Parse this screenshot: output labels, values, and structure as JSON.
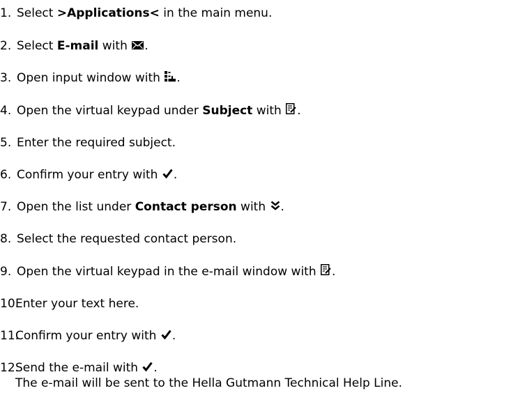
{
  "steps": [
    {
      "num": "1.",
      "pre": "Select ",
      "bold": ">Applications<",
      "post": " in the main menu.",
      "icon": null
    },
    {
      "num": "2.",
      "pre": "Select ",
      "bold": "E-mail",
      "post": " with ",
      "icon": "envelope-icon"
    },
    {
      "num": "3.",
      "pre": "Open input window with ",
      "bold": "",
      "post": "",
      "icon": "new-entry-icon"
    },
    {
      "num": "4.",
      "pre": "Open the virtual keypad under ",
      "bold": "Subject",
      "post": " with ",
      "icon": "edit-icon"
    },
    {
      "num": "5.",
      "pre": "Enter the required subject.",
      "bold": "",
      "post": "",
      "icon": null
    },
    {
      "num": "6.",
      "pre": "Confirm your entry with ",
      "bold": "",
      "post": "",
      "icon": "checkmark-icon"
    },
    {
      "num": "7.",
      "pre": "Open the list under ",
      "bold": "Contact person",
      "post": " with ",
      "icon": "double-chevron-down-icon"
    },
    {
      "num": "8.",
      "pre": "Select the requested contact person.",
      "bold": "",
      "post": "",
      "icon": null
    },
    {
      "num": "9.",
      "pre": "Open the virtual keypad in the e-mail window with ",
      "bold": "",
      "post": "",
      "icon": "edit-icon"
    },
    {
      "num": "10.",
      "pre": "Enter your text here.",
      "bold": "",
      "post": "",
      "icon": null
    },
    {
      "num": "11.",
      "pre": "Confirm your entry with ",
      "bold": "",
      "post": "",
      "icon": "checkmark-icon"
    },
    {
      "num": "12.",
      "pre": "Send the e-mail with ",
      "bold": "",
      "post": "",
      "icon": "checkmark-icon",
      "sub": "The e-mail will be sent to the Hella Gutmann Technical Help Line."
    }
  ],
  "end_punct": "."
}
